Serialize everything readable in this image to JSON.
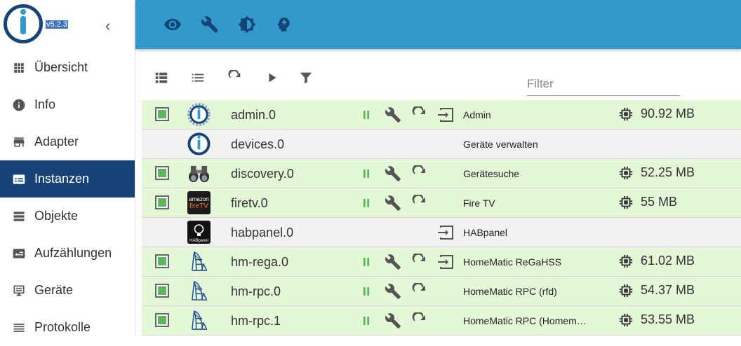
{
  "app": {
    "version": "v5.2.3"
  },
  "sidebar": {
    "items": [
      {
        "label": "Übersicht",
        "icon": "grid-icon"
      },
      {
        "label": "Info",
        "icon": "info-icon"
      },
      {
        "label": "Adapter",
        "icon": "store-icon"
      },
      {
        "label": "Instanzen",
        "icon": "instances-icon",
        "active": true
      },
      {
        "label": "Objekte",
        "icon": "list-icon"
      },
      {
        "label": "Aufzählungen",
        "icon": "enum-icon"
      },
      {
        "label": "Geräte",
        "icon": "device-icon"
      },
      {
        "label": "Protokolle",
        "icon": "log-icon"
      }
    ]
  },
  "topbar": {
    "icons": [
      "eye-icon",
      "wrench-icon",
      "brightness-icon",
      "expert-icon"
    ]
  },
  "toolbar": {
    "filter_placeholder": "Filter"
  },
  "colors": {
    "accent": "#3399cc",
    "sidebar_active": "#164477",
    "row_enabled": "#e4f8d8",
    "row_plain": "#f2f2f2",
    "status_green": "#5fb65f"
  },
  "instances": [
    {
      "name": "admin.0",
      "title": "Admin",
      "memory": "90.92 MB",
      "enabled": true,
      "icon": "iobroker-gear-icon",
      "pause": true,
      "wrench": true,
      "reload": true,
      "link": true
    },
    {
      "name": "devices.0",
      "title": "Geräte verwalten",
      "memory": "",
      "enabled": false,
      "icon": "iobroker-logo-icon",
      "pause": false,
      "wrench": false,
      "reload": false,
      "link": false
    },
    {
      "name": "discovery.0",
      "title": "Gerätesuche",
      "memory": "52.25 MB",
      "enabled": true,
      "icon": "binoculars-icon",
      "pause": true,
      "wrench": true,
      "reload": true,
      "link": false
    },
    {
      "name": "firetv.0",
      "title": "Fire TV",
      "memory": "55 MB",
      "enabled": true,
      "icon": "firetv-icon",
      "icon_text_1": "amazon",
      "icon_text_2": "fireTV",
      "pause": true,
      "wrench": true,
      "reload": true,
      "link": false
    },
    {
      "name": "habpanel.0",
      "title": "HABpanel",
      "memory": "",
      "enabled": false,
      "icon": "habpanel-icon",
      "icon_text_1": "HABpanel",
      "pause": false,
      "wrench": false,
      "reload": false,
      "link": true
    },
    {
      "name": "hm-rega.0",
      "title": "HomeMatic ReGaHSS",
      "memory": "61.02 MB",
      "enabled": true,
      "icon": "homematic-icon",
      "pause": true,
      "wrench": true,
      "reload": true,
      "link": true
    },
    {
      "name": "hm-rpc.0",
      "title": "HomeMatic RPC (rfd)",
      "memory": "54.37 MB",
      "enabled": true,
      "icon": "homematic-icon",
      "pause": true,
      "wrench": true,
      "reload": true,
      "link": false
    },
    {
      "name": "hm-rpc.1",
      "title": "HomeMatic RPC (Homem…",
      "memory": "53.55 MB",
      "enabled": true,
      "icon": "homematic-icon",
      "pause": true,
      "wrench": true,
      "reload": true,
      "link": false
    }
  ]
}
